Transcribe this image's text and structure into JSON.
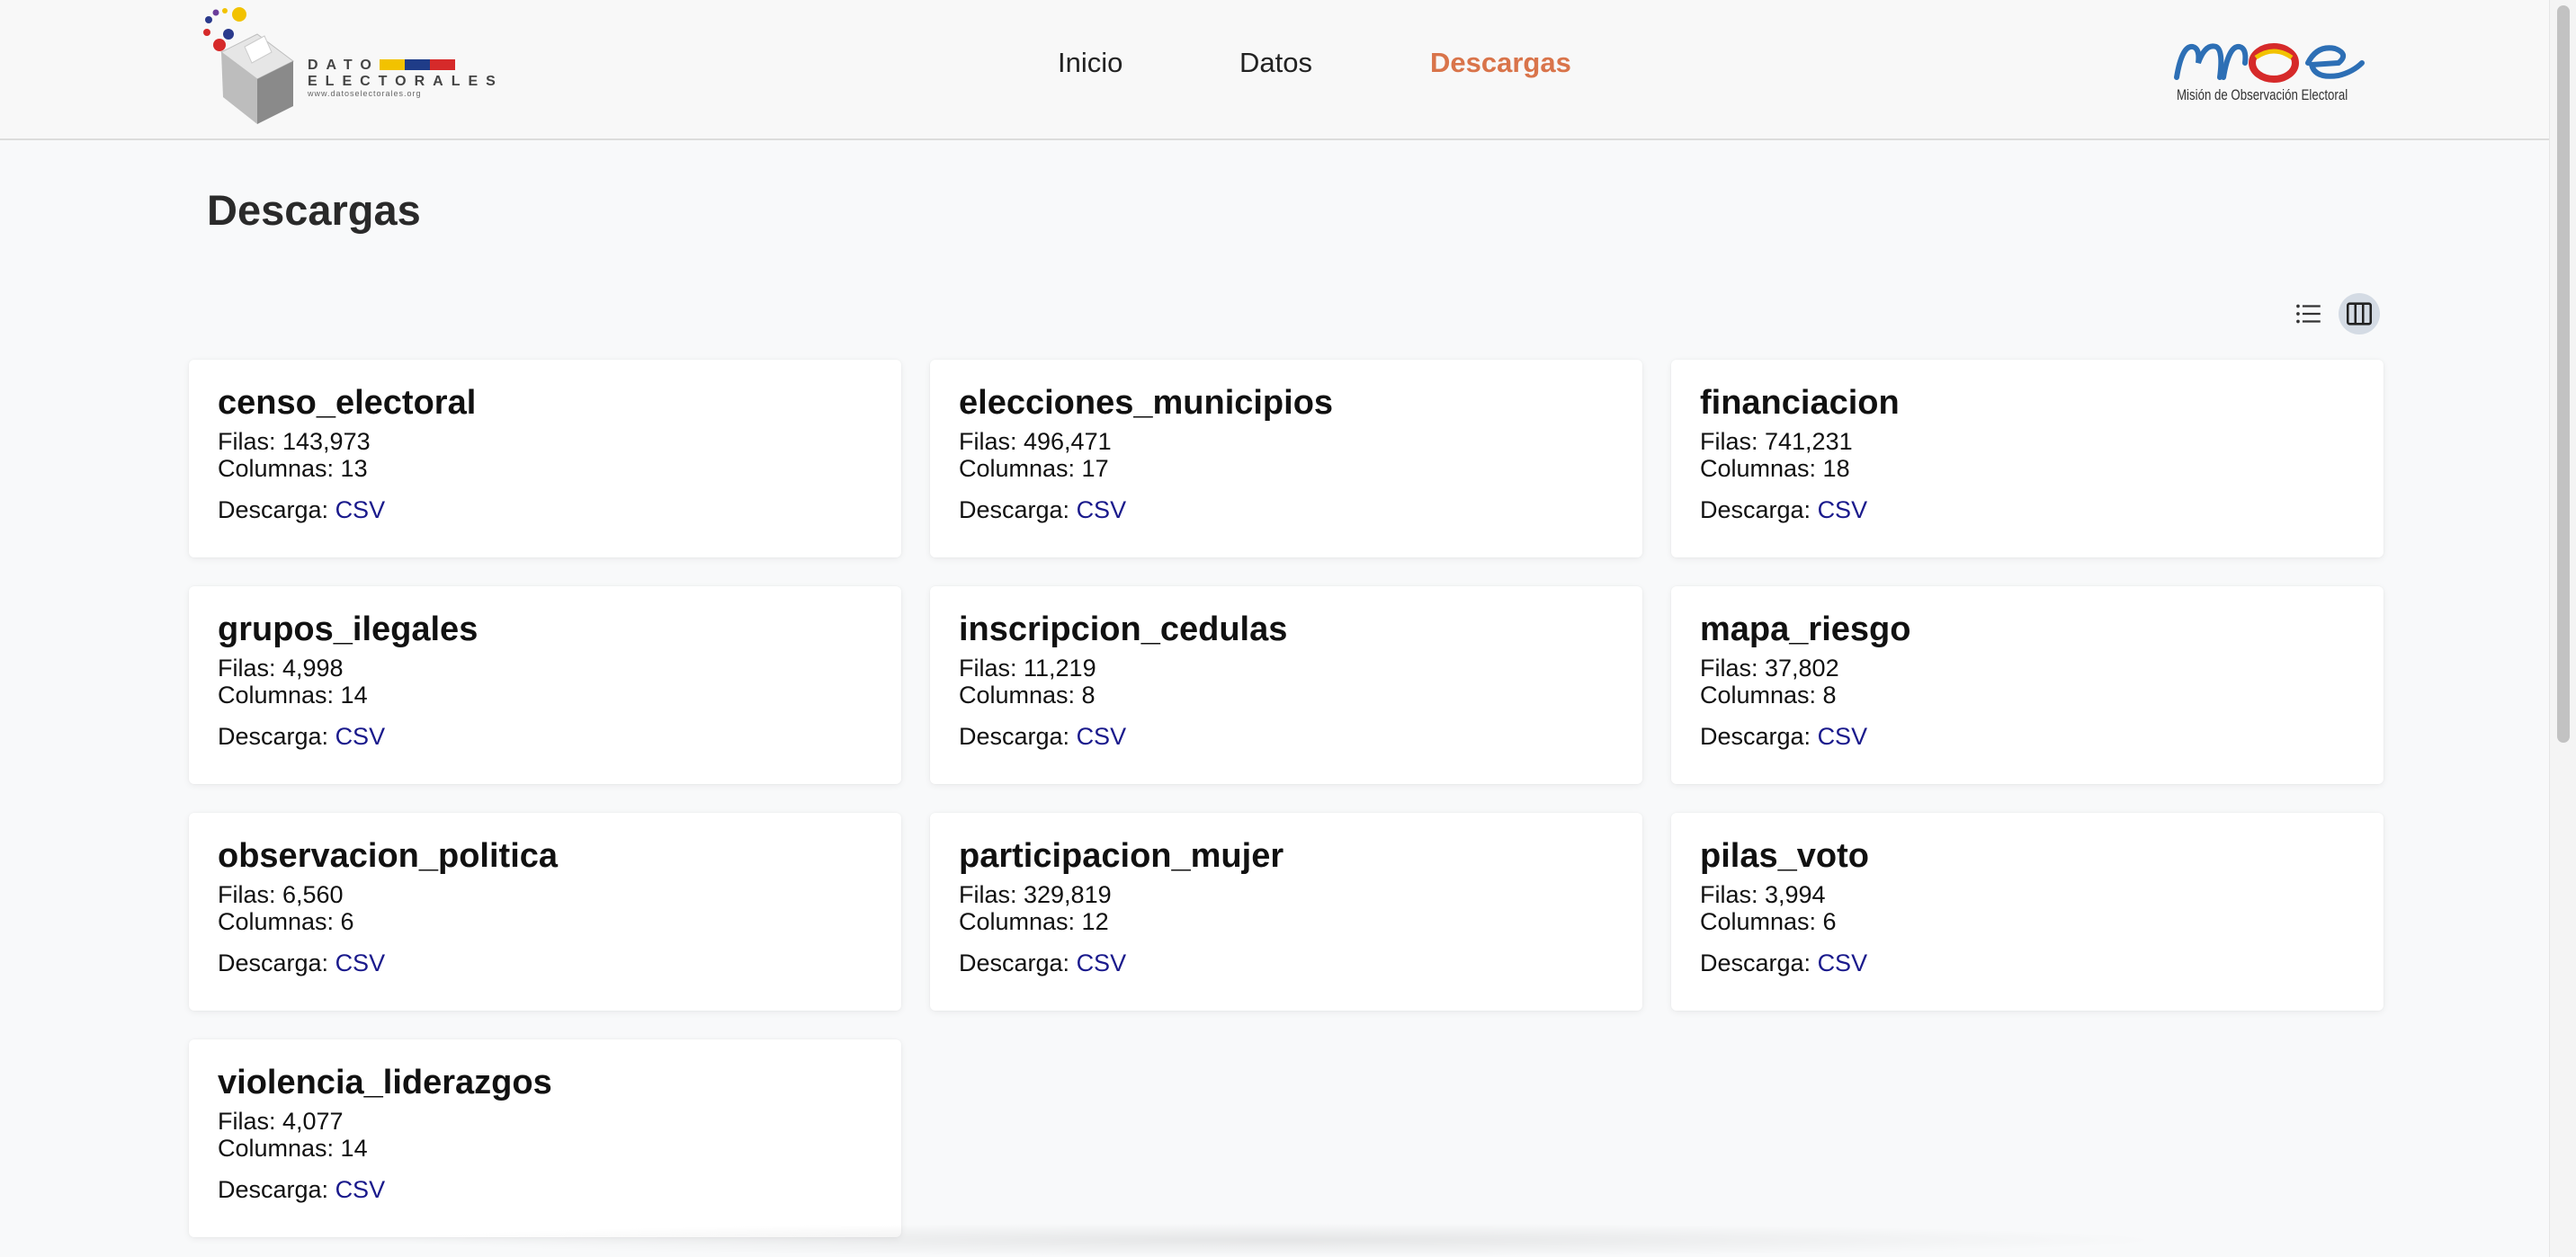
{
  "header": {
    "logo_left": {
      "line1": "DATOS",
      "line2": "ELECTORALES",
      "url": "www.datoselectorales.org",
      "flag_colors": [
        "#f2c200",
        "#1f3c88",
        "#d62a2a"
      ]
    },
    "nav": [
      {
        "label": "Inicio",
        "active": false
      },
      {
        "label": "Datos",
        "active": false
      },
      {
        "label": "Descargas",
        "active": true
      }
    ],
    "logo_right": {
      "mark": "moe",
      "caption": "Misión de Observación Electoral"
    }
  },
  "main": {
    "title": "Descargas",
    "view_toggle": [
      {
        "icon": "list-view-icon",
        "active": false
      },
      {
        "icon": "grid-view-icon",
        "active": true
      }
    ],
    "cards": [
      {
        "name": "censo_electoral",
        "filas_label": "Filas: 143,973",
        "columnas_label": "Columnas: 13",
        "descarga_label": "Descarga: ",
        "link": "CSV"
      },
      {
        "name": "elecciones_municipios",
        "filas_label": "Filas: 496,471",
        "columnas_label": "Columnas: 17",
        "descarga_label": "Descarga: ",
        "link": "CSV"
      },
      {
        "name": "financiacion",
        "filas_label": "Filas: 741,231",
        "columnas_label": "Columnas: 18",
        "descarga_label": "Descarga: ",
        "link": "CSV"
      },
      {
        "name": "grupos_ilegales",
        "filas_label": "Filas: 4,998",
        "columnas_label": "Columnas: 14",
        "descarga_label": "Descarga: ",
        "link": "CSV"
      },
      {
        "name": "inscripcion_cedulas",
        "filas_label": "Filas: 11,219",
        "columnas_label": "Columnas: 8",
        "descarga_label": "Descarga: ",
        "link": "CSV"
      },
      {
        "name": "mapa_riesgo",
        "filas_label": "Filas: 37,802",
        "columnas_label": "Columnas: 8",
        "descarga_label": "Descarga: ",
        "link": "CSV"
      },
      {
        "name": "observacion_politica",
        "filas_label": "Filas: 6,560",
        "columnas_label": "Columnas: 6",
        "descarga_label": "Descarga: ",
        "link": "CSV"
      },
      {
        "name": "participacion_mujer",
        "filas_label": "Filas: 329,819",
        "columnas_label": "Columnas: 12",
        "descarga_label": "Descarga: ",
        "link": "CSV"
      },
      {
        "name": "pilas_voto",
        "filas_label": "Filas: 3,994",
        "columnas_label": "Columnas: 6",
        "descarga_label": "Descarga: ",
        "link": "CSV"
      },
      {
        "name": "violencia_liderazgos",
        "filas_label": "Filas: 4,077",
        "columnas_label": "Columnas: 14",
        "descarga_label": "Descarga: ",
        "link": "CSV"
      }
    ]
  },
  "colors": {
    "accent": "#d9744a",
    "link": "#1a1a8c",
    "background": "#f8f9fa",
    "card": "#ffffff"
  }
}
